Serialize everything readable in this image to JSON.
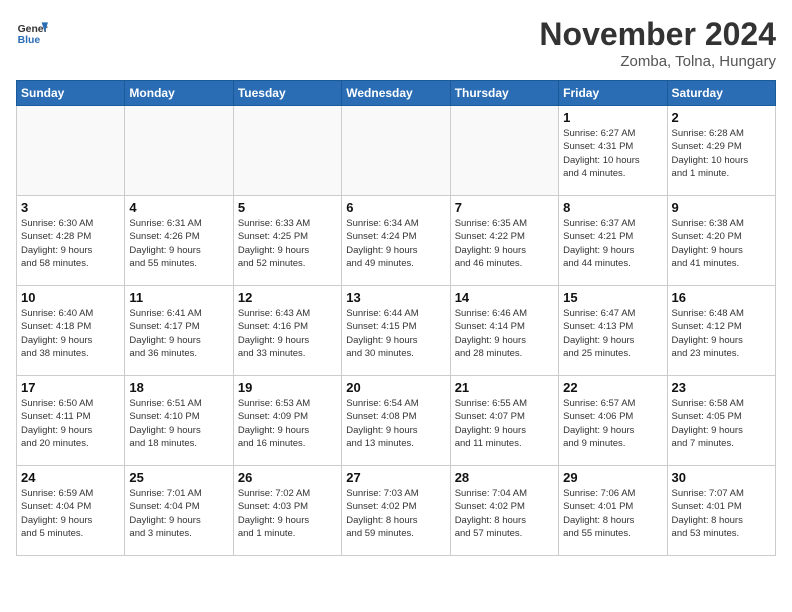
{
  "header": {
    "logo_line1": "General",
    "logo_line2": "Blue",
    "month": "November 2024",
    "location": "Zomba, Tolna, Hungary"
  },
  "weekdays": [
    "Sunday",
    "Monday",
    "Tuesday",
    "Wednesday",
    "Thursday",
    "Friday",
    "Saturday"
  ],
  "weeks": [
    [
      {
        "day": "",
        "info": ""
      },
      {
        "day": "",
        "info": ""
      },
      {
        "day": "",
        "info": ""
      },
      {
        "day": "",
        "info": ""
      },
      {
        "day": "",
        "info": ""
      },
      {
        "day": "1",
        "info": "Sunrise: 6:27 AM\nSunset: 4:31 PM\nDaylight: 10 hours\nand 4 minutes."
      },
      {
        "day": "2",
        "info": "Sunrise: 6:28 AM\nSunset: 4:29 PM\nDaylight: 10 hours\nand 1 minute."
      }
    ],
    [
      {
        "day": "3",
        "info": "Sunrise: 6:30 AM\nSunset: 4:28 PM\nDaylight: 9 hours\nand 58 minutes."
      },
      {
        "day": "4",
        "info": "Sunrise: 6:31 AM\nSunset: 4:26 PM\nDaylight: 9 hours\nand 55 minutes."
      },
      {
        "day": "5",
        "info": "Sunrise: 6:33 AM\nSunset: 4:25 PM\nDaylight: 9 hours\nand 52 minutes."
      },
      {
        "day": "6",
        "info": "Sunrise: 6:34 AM\nSunset: 4:24 PM\nDaylight: 9 hours\nand 49 minutes."
      },
      {
        "day": "7",
        "info": "Sunrise: 6:35 AM\nSunset: 4:22 PM\nDaylight: 9 hours\nand 46 minutes."
      },
      {
        "day": "8",
        "info": "Sunrise: 6:37 AM\nSunset: 4:21 PM\nDaylight: 9 hours\nand 44 minutes."
      },
      {
        "day": "9",
        "info": "Sunrise: 6:38 AM\nSunset: 4:20 PM\nDaylight: 9 hours\nand 41 minutes."
      }
    ],
    [
      {
        "day": "10",
        "info": "Sunrise: 6:40 AM\nSunset: 4:18 PM\nDaylight: 9 hours\nand 38 minutes."
      },
      {
        "day": "11",
        "info": "Sunrise: 6:41 AM\nSunset: 4:17 PM\nDaylight: 9 hours\nand 36 minutes."
      },
      {
        "day": "12",
        "info": "Sunrise: 6:43 AM\nSunset: 4:16 PM\nDaylight: 9 hours\nand 33 minutes."
      },
      {
        "day": "13",
        "info": "Sunrise: 6:44 AM\nSunset: 4:15 PM\nDaylight: 9 hours\nand 30 minutes."
      },
      {
        "day": "14",
        "info": "Sunrise: 6:46 AM\nSunset: 4:14 PM\nDaylight: 9 hours\nand 28 minutes."
      },
      {
        "day": "15",
        "info": "Sunrise: 6:47 AM\nSunset: 4:13 PM\nDaylight: 9 hours\nand 25 minutes."
      },
      {
        "day": "16",
        "info": "Sunrise: 6:48 AM\nSunset: 4:12 PM\nDaylight: 9 hours\nand 23 minutes."
      }
    ],
    [
      {
        "day": "17",
        "info": "Sunrise: 6:50 AM\nSunset: 4:11 PM\nDaylight: 9 hours\nand 20 minutes."
      },
      {
        "day": "18",
        "info": "Sunrise: 6:51 AM\nSunset: 4:10 PM\nDaylight: 9 hours\nand 18 minutes."
      },
      {
        "day": "19",
        "info": "Sunrise: 6:53 AM\nSunset: 4:09 PM\nDaylight: 9 hours\nand 16 minutes."
      },
      {
        "day": "20",
        "info": "Sunrise: 6:54 AM\nSunset: 4:08 PM\nDaylight: 9 hours\nand 13 minutes."
      },
      {
        "day": "21",
        "info": "Sunrise: 6:55 AM\nSunset: 4:07 PM\nDaylight: 9 hours\nand 11 minutes."
      },
      {
        "day": "22",
        "info": "Sunrise: 6:57 AM\nSunset: 4:06 PM\nDaylight: 9 hours\nand 9 minutes."
      },
      {
        "day": "23",
        "info": "Sunrise: 6:58 AM\nSunset: 4:05 PM\nDaylight: 9 hours\nand 7 minutes."
      }
    ],
    [
      {
        "day": "24",
        "info": "Sunrise: 6:59 AM\nSunset: 4:04 PM\nDaylight: 9 hours\nand 5 minutes."
      },
      {
        "day": "25",
        "info": "Sunrise: 7:01 AM\nSunset: 4:04 PM\nDaylight: 9 hours\nand 3 minutes."
      },
      {
        "day": "26",
        "info": "Sunrise: 7:02 AM\nSunset: 4:03 PM\nDaylight: 9 hours\nand 1 minute."
      },
      {
        "day": "27",
        "info": "Sunrise: 7:03 AM\nSunset: 4:02 PM\nDaylight: 8 hours\nand 59 minutes."
      },
      {
        "day": "28",
        "info": "Sunrise: 7:04 AM\nSunset: 4:02 PM\nDaylight: 8 hours\nand 57 minutes."
      },
      {
        "day": "29",
        "info": "Sunrise: 7:06 AM\nSunset: 4:01 PM\nDaylight: 8 hours\nand 55 minutes."
      },
      {
        "day": "30",
        "info": "Sunrise: 7:07 AM\nSunset: 4:01 PM\nDaylight: 8 hours\nand 53 minutes."
      }
    ]
  ]
}
